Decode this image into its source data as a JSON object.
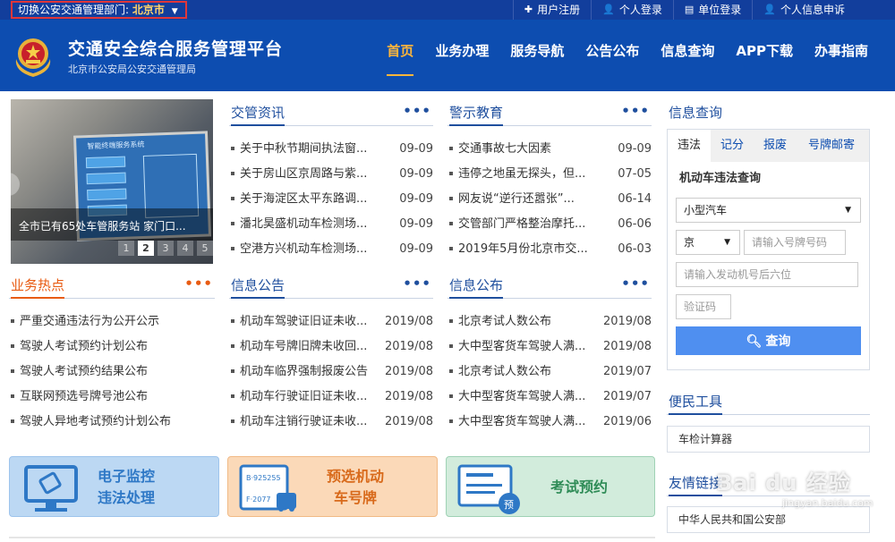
{
  "topbar": {
    "region_label": "切换公安交通管理部门:",
    "region_city": "北京市",
    "links": [
      {
        "icon": "plus-icon",
        "label": "用户注册"
      },
      {
        "icon": "user-icon",
        "label": "个人登录"
      },
      {
        "icon": "document-icon",
        "label": "单位登录"
      },
      {
        "icon": "user-icon",
        "label": "个人信息申诉"
      }
    ]
  },
  "header": {
    "title": "交通安全综合服务管理平台",
    "subtitle": "北京市公安局公安交通管理局",
    "nav": [
      "首页",
      "业务办理",
      "服务导航",
      "公告公布",
      "信息查询",
      "APP下载",
      "办事指南"
    ],
    "active_nav": "首页"
  },
  "carousel": {
    "caption": "全市已有65处车管服务站 家门口...",
    "dots": [
      "1",
      "2",
      "3",
      "4",
      "5"
    ],
    "active_dot": "2",
    "screen_text": "智能终端服务系统"
  },
  "news": {
    "title": "交管资讯",
    "more": "•••",
    "items": [
      {
        "text": "关于中秋节期间执法窗...",
        "date": "09-09"
      },
      {
        "text": "关于房山区京周路与紫...",
        "date": "09-09"
      },
      {
        "text": "关于海淀区太平东路调...",
        "date": "09-09"
      },
      {
        "text": "潘北昊盛机动车检测场...",
        "date": "09-09"
      },
      {
        "text": "空港方兴机动车检测场...",
        "date": "09-09"
      }
    ]
  },
  "warning": {
    "title": "警示教育",
    "more": "•••",
    "items": [
      {
        "text": "交通事故七大因素",
        "date": "09-09"
      },
      {
        "text": "违停之地虽无探头，但...",
        "date": "07-05"
      },
      {
        "text": "网友说“逆行还嚣张”...",
        "date": "06-14"
      },
      {
        "text": "交管部门严格整治摩托...",
        "date": "06-06"
      },
      {
        "text": "2019年5月份北京市交...",
        "date": "06-03"
      }
    ]
  },
  "hot": {
    "title": "业务热点",
    "more": "•••",
    "items": [
      "严重交通违法行为公开公示",
      "驾驶人考试预约计划公布",
      "驾驶人考试预约结果公布",
      "互联网预选号牌号池公布",
      "驾驶人异地考试预约计划公布"
    ]
  },
  "notice": {
    "title": "信息公告",
    "more": "•••",
    "items": [
      {
        "text": "机动车驾驶证旧证未收...",
        "date": "2019/08"
      },
      {
        "text": "机动车号牌旧牌未收回...",
        "date": "2019/08"
      },
      {
        "text": "机动车临界强制报废公告",
        "date": "2019/08"
      },
      {
        "text": "机动车行驶证旧证未收...",
        "date": "2019/08"
      },
      {
        "text": "机动车注销行驶证未收...",
        "date": "2019/08"
      }
    ]
  },
  "publish": {
    "title": "信息公布",
    "more": "•••",
    "items": [
      {
        "text": "北京考试人数公布",
        "date": "2019/08"
      },
      {
        "text": "大中型客货车驾驶人满...",
        "date": "2019/08"
      },
      {
        "text": "北京考试人数公布",
        "date": "2019/07"
      },
      {
        "text": "大中型客货车驾驶人满...",
        "date": "2019/07"
      },
      {
        "text": "大中型客货车驾驶人满...",
        "date": "2019/06"
      }
    ]
  },
  "query": {
    "title": "信息查询",
    "tabs": [
      "违法",
      "记分",
      "报废",
      "号牌邮寄"
    ],
    "active_tab": "违法",
    "subtitle": "机动车违法查询",
    "vehicle_type": "小型汽车",
    "province": "京",
    "plate_placeholder": "请输入号牌号码",
    "engine_placeholder": "请输入发动机号后六位",
    "captcha_placeholder": "验证码",
    "search_label": "查询"
  },
  "tools": {
    "title": "便民工具",
    "items": [
      "车检计算器"
    ]
  },
  "links": {
    "title": "友情链接",
    "items": [
      "中华人民共和国公安部"
    ]
  },
  "tiles": [
    {
      "line1": "电子监控",
      "line2": "违法处理"
    },
    {
      "line1": "预选机动",
      "line2": "车号牌"
    },
    {
      "line1": "考试预约"
    }
  ],
  "tile_plate_texts": {
    "top": "B·925255",
    "bottom": "F·2077",
    "badge": "预"
  },
  "watermark": {
    "brand": "Bai du 经验",
    "url": "jingyan.baidu.com"
  }
}
